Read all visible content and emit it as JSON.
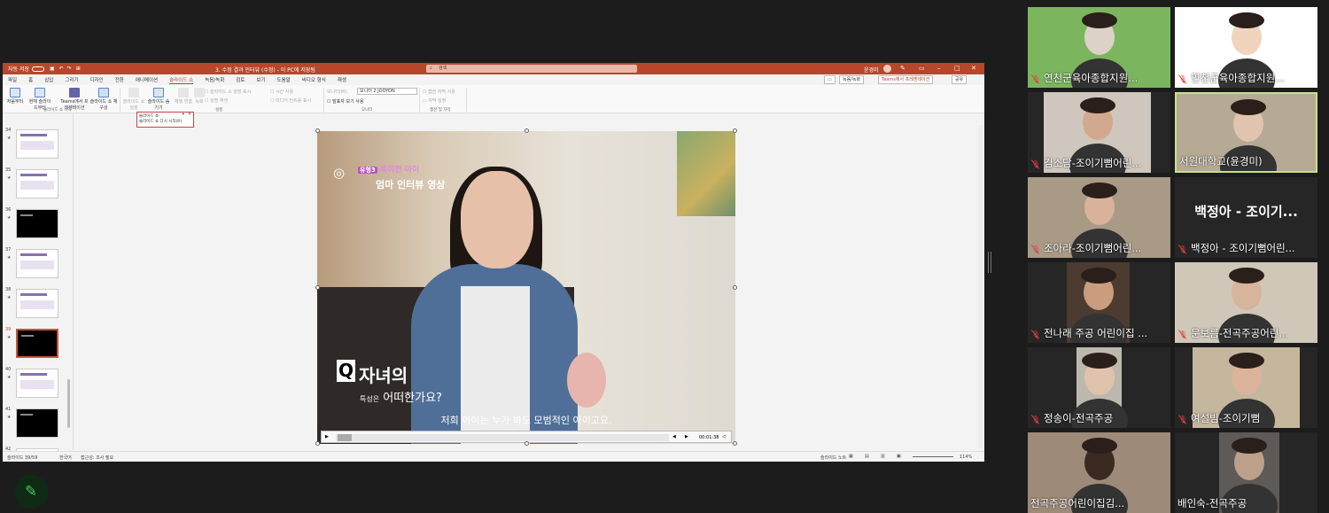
{
  "app": {
    "autosave_label": "자동 저장",
    "doc_title": "3. 수정 결과 인터뷰 (수정) - 이 PC에 저장됨",
    "search_placeholder": "검색",
    "user": "윤경미"
  },
  "menu": {
    "items": [
      "파일",
      "홈",
      "삽입",
      "그리기",
      "디자인",
      "전환",
      "애니메이션",
      "슬라이드 쇼",
      "녹음/녹화",
      "검토",
      "보기",
      "도움말",
      "비디오 형식",
      "재생"
    ],
    "active": "슬라이드 쇼",
    "recording_label": "녹음/녹화",
    "teams_present_label": "Teams에서 프레젠테이션",
    "share_label": "공유"
  },
  "ribbon": {
    "btn_from_start": "처음부터",
    "btn_from_current": "현재 슬라이드부터",
    "btn_teams": "Teams에서 프레젠테이션",
    "btn_custom": "슬라이드 쇼 재구성",
    "btn_setup": "슬라이드 쇼 설정",
    "btn_hide": "슬라이드 숨기기",
    "btn_rehearse": "예행 연습",
    "btn_record": "녹화",
    "opt_play_narration": "슬라이드 쇼 설명 표시",
    "opt_use_timings": "시간 사용",
    "opt_show_controls": "미디어 컨트롤 표시",
    "opt_subtitles": "설명 재생",
    "monitor_label": "모니터(M):",
    "monitor_value": "모니터 2 JOOYON",
    "presenter_view": "발표자 보기 사용",
    "group_start": "슬라이드 쇼 시작",
    "group_setup": "설정",
    "group_monitor": "모니터",
    "group_caption": "캡션 및 자막",
    "caption_settings": "캡션 자막 사용",
    "subtitle_settings": "자막 설정"
  },
  "popup": {
    "title": "슬라이드 쇼",
    "item": "슬라이드 쇼 다시 시작(R)"
  },
  "thumbnails": [
    {
      "num": "34",
      "dark": false
    },
    {
      "num": "35",
      "dark": false
    },
    {
      "num": "36",
      "dark": true
    },
    {
      "num": "37",
      "dark": false
    },
    {
      "num": "38",
      "dark": false
    },
    {
      "num": "39",
      "dark": true,
      "selected": true
    },
    {
      "num": "40",
      "dark": false
    },
    {
      "num": "41",
      "dark": true
    },
    {
      "num": "42",
      "dark": false
    }
  ],
  "slide": {
    "tag": "유형3",
    "tag_title": "특이한 아이",
    "subtitle_label": "엄마 인터뷰 영상",
    "q_mark": "Q",
    "q_line1": "자녀의",
    "q_line2_small": "특성은",
    "q_line2": "어떠한가요?",
    "caption": "저희 아이는 누가 봐도 모범적인 아이고요.",
    "time": "00:01:38"
  },
  "status": {
    "slide_count": "슬라이드 39/59",
    "language": "한국어",
    "accessibility": "접근성: 조사 필요",
    "notes": "슬라이드 노트",
    "zoom": "114%"
  },
  "participants": [
    {
      "name": "연천군육아종합지원...",
      "muted": true
    },
    {
      "name": "연천군육아종합지원...",
      "muted": true
    },
    {
      "name": "김소담-조이기뻠어린...",
      "muted": true
    },
    {
      "name": "서원대학교(윤경미)",
      "muted": false,
      "speaking": true
    },
    {
      "name": "조아라-조이기뻠어린...",
      "muted": true
    },
    {
      "name": "백정아 - 조이기뻠어린...",
      "muted": true,
      "big_name": "백정아 - 조이기..."
    },
    {
      "name": "전나래 주공 어린이집 ...",
      "muted": true
    },
    {
      "name": "문보름-전곡주공어린...",
      "muted": true
    },
    {
      "name": "정송이-전곡주공",
      "muted": true
    },
    {
      "name": "여설빔-조이기뻠",
      "muted": true
    },
    {
      "name": "전곡주공어린이집김...",
      "muted": false
    },
    {
      "name": "배인숙-전곡주공",
      "muted": false
    }
  ],
  "colors": {
    "powerpoint_red": "#b7472a",
    "speaking_border": "#c7e08a",
    "mute_red": "#e04040",
    "background": "#1c1c1c"
  }
}
